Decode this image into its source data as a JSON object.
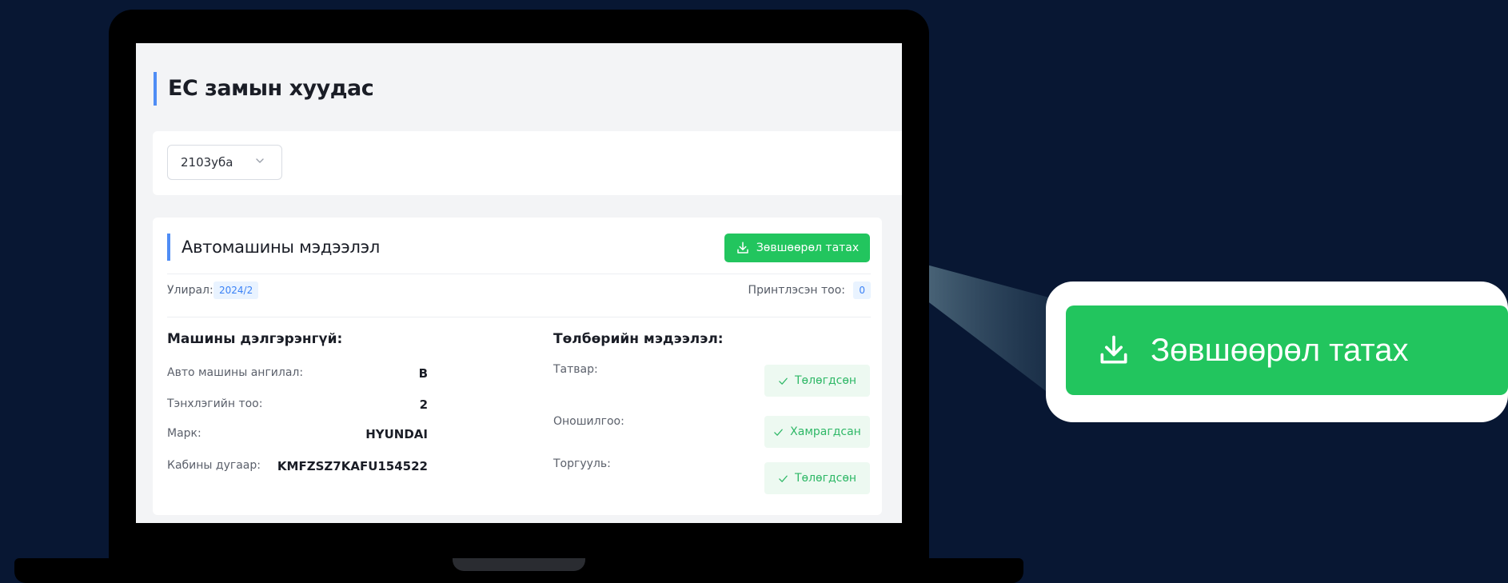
{
  "page": {
    "title": "ЕС замын хуудас"
  },
  "filter": {
    "year_value": "2103уба"
  },
  "card": {
    "title": "Автомашины мэдээлэл",
    "download_label": "Зөвшөөрөл татах",
    "season_label": "Улирал:",
    "season_value": "2024/2",
    "printed_label": "Принтлэсэн тоо:",
    "printed_value": "0",
    "vehicle": {
      "heading": "Машины дэлгэрэнгүй:",
      "rows": [
        {
          "label": "Авто машины ангилал:",
          "value": "B"
        },
        {
          "label": "Тэнхлэгийн тоо:",
          "value": "2"
        },
        {
          "label": "Марк:",
          "value": "HYUNDAI"
        },
        {
          "label": "Кабины дугаар:",
          "value": "KMFZSZ7KAFU154522"
        }
      ]
    },
    "payment": {
      "heading": "Төлбөрийн мэдээлэл:",
      "rows": [
        {
          "label": "Татвар:",
          "status": "Төлөгдсөн"
        },
        {
          "label": "Оношилгоо:",
          "status": "Хамрагдсан"
        },
        {
          "label": "Торгууль:",
          "status": "Төлөгдсөн"
        }
      ]
    }
  },
  "zoom": {
    "download_label": "Зөвшөөрөл татах"
  },
  "colors": {
    "background": "#081733",
    "accent_green": "#22c55e",
    "accent_blue": "#4f8df5",
    "status_green_text": "#2fb867",
    "status_green_bg": "#edf9f1"
  },
  "icons": {
    "download": "download-icon",
    "check": "check-icon",
    "chevron": "chevron-down-icon"
  }
}
